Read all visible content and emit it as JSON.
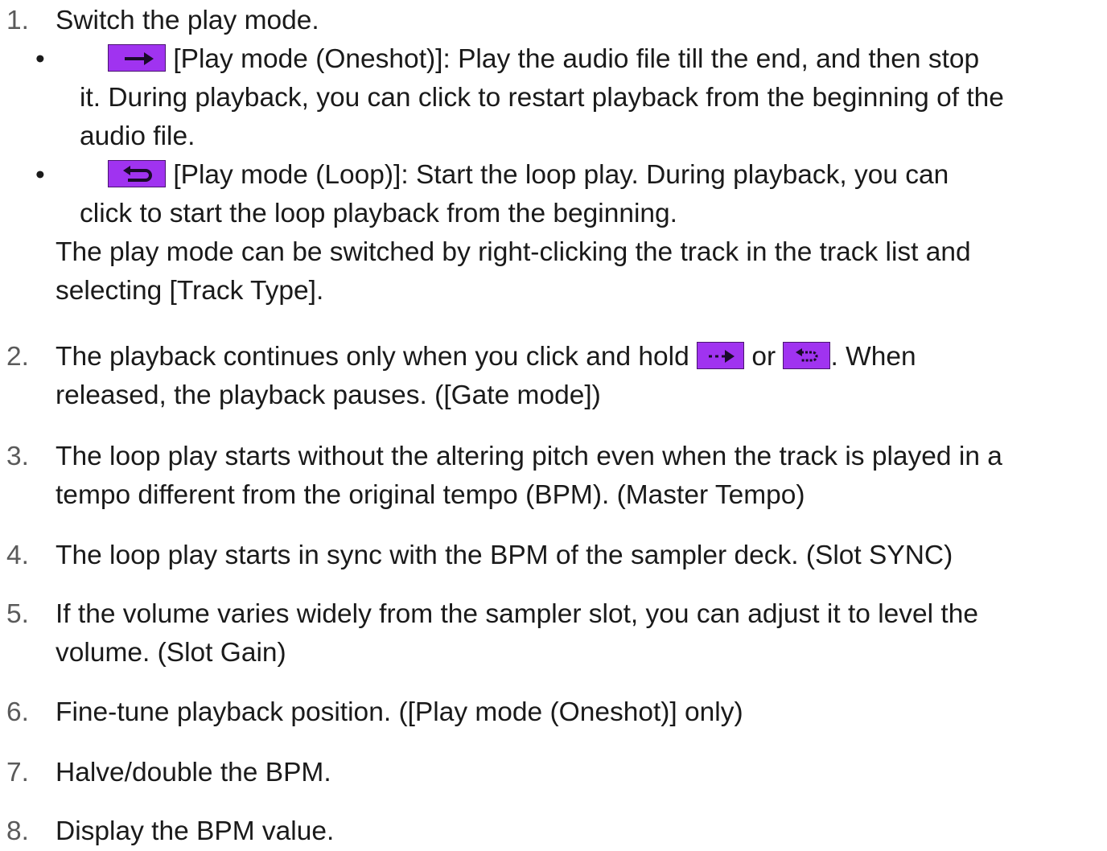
{
  "items": [
    {
      "number": "1.",
      "text": "Switch the play mode.",
      "bullets": [
        {
          "icon": "play-mode-oneshot-icon",
          "line1": "[Play mode (Oneshot)]: Play the audio file till the end, and then stop",
          "line2": "it. During playback, you can click to restart playback from the beginning of the",
          "line3": "audio file."
        },
        {
          "icon": "play-mode-loop-icon",
          "line1": "[Play mode (Loop)]: Start the loop play. During playback, you can",
          "line2": "click to start the loop playback from the beginning."
        }
      ],
      "note_line1": "The play mode can be switched by right-clicking the track in the track list and",
      "note_line2": "selecting [Track Type]."
    },
    {
      "number": "2.",
      "text_before": "The playback continues only when you click and hold",
      "text_or": "or",
      "text_after": ". When",
      "line2": "released, the playback pauses. ([Gate mode])",
      "icons": [
        "gate-oneshot-icon",
        "gate-loop-icon"
      ]
    },
    {
      "number": "3.",
      "line1": "The loop play starts without the altering pitch even when the track is played in a",
      "line2": "tempo different from the original tempo (BPM). (Master Tempo)"
    },
    {
      "number": "4.",
      "line1": "The loop play starts in sync with the BPM of the sampler deck. (Slot SYNC)"
    },
    {
      "number": "5.",
      "line1": "If the volume varies widely from the sampler slot, you can adjust it to level the",
      "line2": "volume. (Slot Gain)"
    },
    {
      "number": "6.",
      "line1": "Fine-tune playback position. ([Play mode (Oneshot)] only)"
    },
    {
      "number": "7.",
      "line1": "Halve/double the BPM."
    },
    {
      "number": "8.",
      "line1": "Display the BPM value."
    }
  ],
  "colors": {
    "icon_fill": "#a033f0",
    "icon_border": "#4a1470",
    "text": "#1a1a1a",
    "number": "#5a5a5a"
  }
}
